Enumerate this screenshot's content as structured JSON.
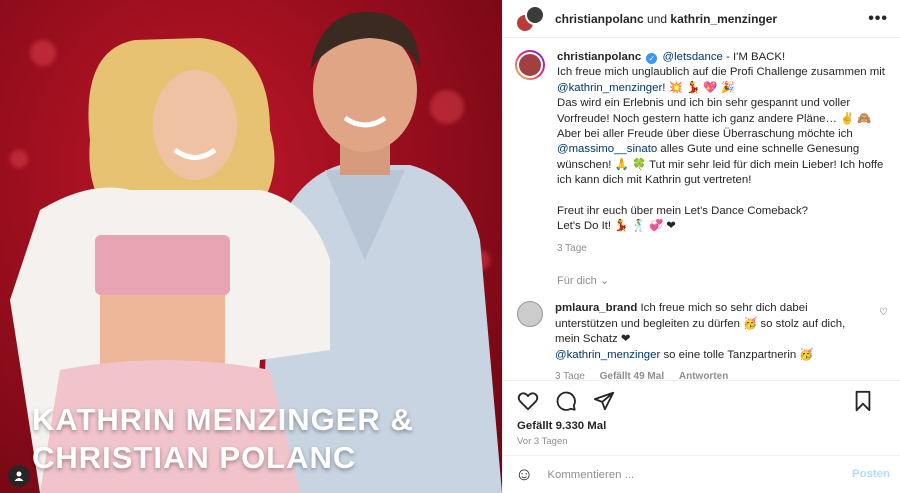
{
  "media": {
    "caption_line1": "KATHRIN MENZINGER &",
    "caption_line2": "CHRISTIAN POLANC"
  },
  "header": {
    "user1": "christianpolanc",
    "conjunction": "und",
    "user2": "kathrin_menzinger",
    "more_icon": "more-icon"
  },
  "post": {
    "author": "christianpolanc",
    "mention_letsdance": "@letsdance",
    "line1": " - I'M BACK!",
    "line2": "Ich freue mich unglaublich auf die Profi Challenge zusammen mit",
    "mention_kathrin": "@kathrin_menzinger",
    "line3_tail": "! 💥 💃 💖 🎉",
    "line4": "Das wird ein Erlebnis und ich bin sehr gespannt und voller Vorfreude! Noch gestern hatte ich ganz andere Pläne… ✌ 🙈",
    "line5": "Aber bei aller Freude über diese Überraschung möchte ich",
    "mention_massimo": "@massimo__sinato",
    "line6": " alles Gute und eine schnelle Genesung wünschen! 🙏 🍀 Tut mir sehr leid für dich mein Lieber! Ich hoffe ich kann dich mit Kathrin gut vertreten!",
    "line7": "Freut ihr euch über mein Let's Dance Comeback?",
    "line8": "Let's Do It! 💃 🕺 💞 ❤",
    "age": "3 Tage",
    "translate": "Für dich"
  },
  "comment": {
    "author": "pmlaura_brand",
    "text1": " Ich freue mich so sehr dich dabei unterstützen und begleiten zu dürfen 🥳 so stolz auf dich, mein Schatz ❤",
    "mention": "@kathrin_menzinger",
    "text2": " so eine tolle Tanzpartnerin 🥳",
    "age": "3 Tage",
    "likes": "Gefällt 49 Mal",
    "reply": "Antworten"
  },
  "actions": {
    "likes": "Gefällt 9.330 Mal",
    "ago": "Vor 3 Tagen"
  },
  "compose": {
    "placeholder": "Kommentieren ...",
    "post_label": "Posten"
  },
  "colors": {
    "link": "#00376b",
    "post_button": "#b3dbff",
    "background_red": "#9a0e1e"
  }
}
